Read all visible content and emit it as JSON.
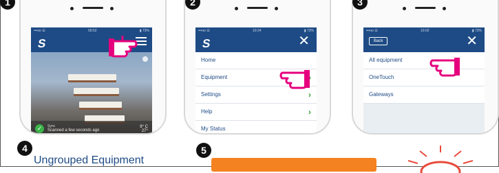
{
  "steps": [
    "1",
    "2",
    "3",
    "4",
    "5"
  ],
  "phone1": {
    "status_left": "•••oo ☰",
    "status_time": "09:52",
    "status_right": "▮ 73%",
    "logo": "S",
    "status_line1": "Sync",
    "status_line2": "Scanned a few seconds ago",
    "temp_top": "9°",
    "temp_unit": "C",
    "temp_bottom": "27°"
  },
  "phone2": {
    "status_left": "•••oo ☰",
    "status_time": "10:24",
    "status_right": "▮ 73%",
    "logo": "S",
    "menu_items": [
      "Home",
      "Equipment",
      "Settings",
      "Help",
      "My Status"
    ]
  },
  "phone3": {
    "status_left": "•••oo ☰",
    "status_time": "10:02",
    "status_right": "▮ 73%",
    "back_label": "Back",
    "menu_items": [
      "All equipment",
      "OneTouch",
      "Gateways"
    ]
  },
  "section4": {
    "title": "Ungrouped Equipment"
  },
  "colors": {
    "brand_blue": "#1e4b85",
    "accent_green": "#39a23a",
    "accent_orange": "#f58220",
    "hand_pink": "#e6007e"
  }
}
